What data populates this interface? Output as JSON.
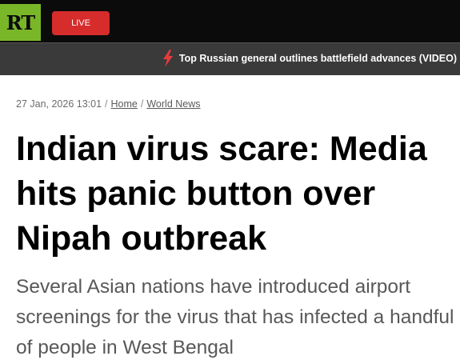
{
  "header": {
    "logo_text": "RT",
    "live_label": "LIVE",
    "ticker_icon": "lightning-bolt-icon",
    "ticker_text": "Top Russian general outlines battlefield advances (VIDEO)"
  },
  "article": {
    "timestamp": "27 Jan, 2026 13:01",
    "breadcrumb": [
      "Home",
      "World News"
    ],
    "headline": "Indian virus scare: Media hits panic button over Nipah outbreak",
    "summary": "Several Asian nations have introduced airport screenings for the virus that has infected a handful of people in West Bengal"
  },
  "colors": {
    "brand_green": "#79b729",
    "live_red": "#d62c2c",
    "header_bg": "#0b0b0b",
    "ticker_bg": "#3a3a3a",
    "bolt_red": "#e63b3b"
  }
}
